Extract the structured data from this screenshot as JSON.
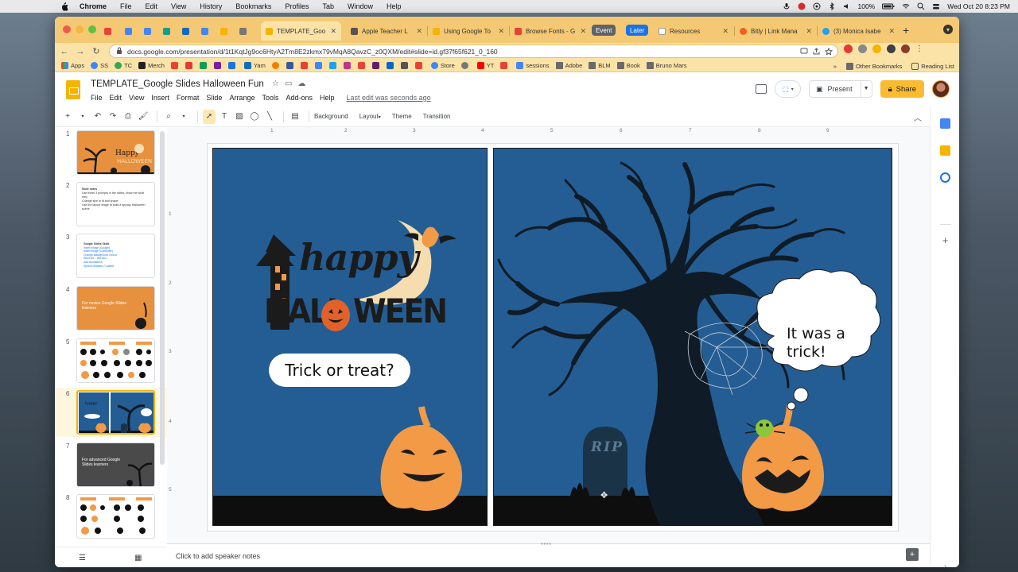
{
  "menubar": {
    "app": "Chrome",
    "items": [
      "File",
      "Edit",
      "View",
      "History",
      "Bookmarks",
      "Profiles",
      "Tab",
      "Window",
      "Help"
    ],
    "battery": "100%",
    "datetime": "Wed Oct 20  8:23 PM"
  },
  "tabs": [
    {
      "label": "TEMPLATE_Goo",
      "color": "#f4b400"
    },
    {
      "label": "Apple Teacher L",
      "color": "#555555"
    },
    {
      "label": "Using Google To",
      "color": "#f4b400"
    },
    {
      "label": "Browse Fonts - G",
      "color": "#e94235"
    },
    {
      "label": "Resources",
      "color": "#ffffff"
    },
    {
      "label": "Bitly | Link Mana",
      "color": "#ee6123"
    },
    {
      "label": "(3) Monica Isabe",
      "color": "#1da1f2"
    }
  ],
  "tab_groups": {
    "event": "Event",
    "later": "Later"
  },
  "address": {
    "url": "docs.google.com/presentation/d/1t1KqtJg9oc6HtyA2Tm8E2zkmx79vMqA8QavzC_z0QXM/edit#slide=id.gf37f65f621_0_160"
  },
  "bookmarks": {
    "items": [
      {
        "label": "Apps",
        "icon": "apps-grid-icon"
      },
      {
        "label": "SS",
        "icon": "google-icon"
      },
      {
        "label": "TC",
        "icon": "google-icon"
      },
      {
        "label": "Merch",
        "icon": "amazon-icon"
      },
      {
        "label": "Yam",
        "icon": "yammer-icon"
      },
      {
        "label": "Store",
        "icon": "google-icon"
      },
      {
        "label": "YT",
        "icon": "youtube-icon"
      },
      {
        "label": "sessions",
        "icon": "docs-icon"
      },
      {
        "label": "Adobe",
        "icon": "folder-icon"
      },
      {
        "label": "BLM",
        "icon": "folder-icon"
      },
      {
        "label": "Book",
        "icon": "folder-icon"
      },
      {
        "label": "Bruno Mars",
        "icon": "folder-icon"
      }
    ],
    "overflow": "»",
    "other": "Other Bookmarks",
    "reading_list": "Reading List"
  },
  "docs": {
    "title": "TEMPLATE_Google Slides Halloween Fun",
    "menu": [
      "File",
      "Edit",
      "View",
      "Insert",
      "Format",
      "Slide",
      "Arrange",
      "Tools",
      "Add-ons",
      "Help"
    ],
    "last_edit": "Last edit was seconds ago",
    "present_label": "Present",
    "share_label": "Share"
  },
  "toolbar": {
    "background": "Background",
    "layout": "Layout",
    "theme": "Theme",
    "transition": "Transition"
  },
  "filmstrip": {
    "numbers": [
      "1",
      "2",
      "3",
      "4",
      "5",
      "6",
      "7",
      "8"
    ],
    "active_index": 6,
    "slide2": {
      "heading": "Slide notes",
      "lines": [
        "Use these 3 prompts in the slides, show me what they",
        "Change size to fit and shape",
        "Use the layout image to build a spooky Halloween scene"
      ]
    },
    "slide3": {
      "heading": "Google Slides Skills",
      "links": [
        "Insert Image (Google)",
        "Insert Image (Computer)",
        "Change Background Colour",
        "Word Art - Text Box",
        "Add Animations",
        "Speech Bubbles / Callout"
      ]
    },
    "slide4": {
      "caption": "For novice Google Slides learners"
    },
    "slide7": {
      "caption": "For advanced Google Slides learners"
    }
  },
  "slide": {
    "happy_text": "happy",
    "halloween_left": "HALL",
    "halloween_right": "WEEN",
    "left_bubble": "Trick or treat?",
    "right_bubble_line1": "It was a",
    "right_bubble_line2": "trick!",
    "tombstone": "RIP",
    "colors": {
      "background": "#245d93",
      "ground": "#0e0e0e",
      "pumpkin": "#f29a45",
      "moon": "#f6ddb0",
      "tree": "#0f1b26"
    }
  },
  "ruler": {
    "top": [
      "1",
      "2",
      "3",
      "4",
      "5",
      "6",
      "7",
      "8",
      "9"
    ],
    "left": [
      "1",
      "2",
      "3",
      "4",
      "5"
    ]
  },
  "notes": {
    "placeholder": "Click to add speaker notes"
  }
}
